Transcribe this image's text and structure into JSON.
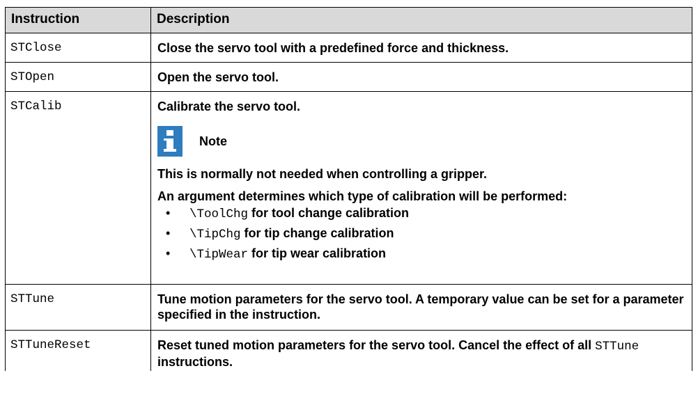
{
  "table": {
    "headers": {
      "instruction": "Instruction",
      "description": "Description"
    },
    "rows": [
      {
        "instruction": "STClose",
        "description": "Close the servo tool with a predefined force and thickness."
      },
      {
        "instruction": "STOpen",
        "description": "Open the servo tool."
      },
      {
        "instruction": "STCalib",
        "description": "Calibrate the servo tool.",
        "note": {
          "icon": "info-icon",
          "icon_color": "#2e7dbf",
          "title": "Note",
          "text": "This is normally not needed when controlling a gripper."
        },
        "argument_text": "An argument determines which type of calibration will be performed:",
        "bullets": [
          {
            "code": "\\ToolChg",
            "text": " for tool change calibration"
          },
          {
            "code": "\\TipChg",
            "text": " for tip change calibration"
          },
          {
            "code": "\\TipWear",
            "text": " for tip wear calibration"
          }
        ]
      },
      {
        "instruction": "STTune",
        "description": "Tune motion parameters for the servo tool. A temporary value can be set for a parameter specified in the instruction."
      },
      {
        "instruction": "STTuneReset",
        "description_before": "Reset tuned motion parameters for the servo tool. Cancel the effect of all ",
        "description_code": "STTune",
        "description_after": " instructions."
      }
    ],
    "bullet_char": "•"
  }
}
